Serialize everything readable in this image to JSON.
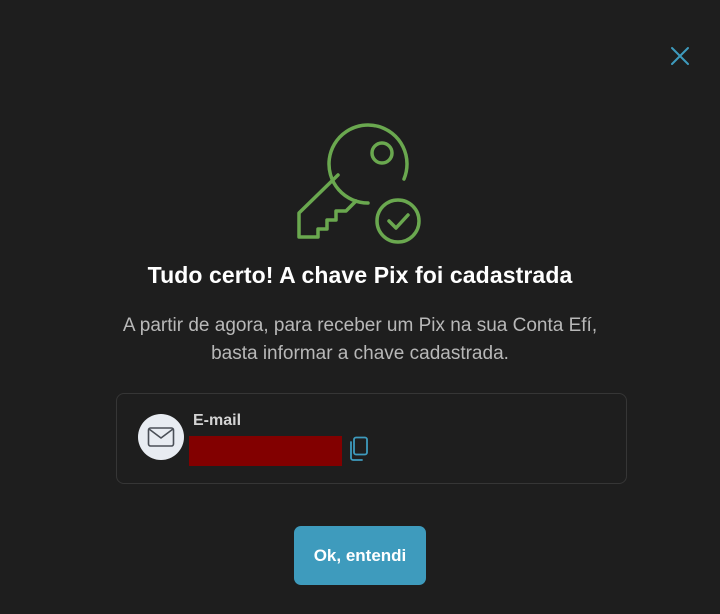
{
  "modal": {
    "title": "Tudo certo! A chave Pix foi cadastrada",
    "description": "A partir de agora, para receber um Pix na sua Conta Efí, basta informar a chave cadastrada.",
    "close_icon": "close-icon",
    "hero_icon": "key-with-check-icon"
  },
  "key_card": {
    "type_label": "E-mail",
    "value": "",
    "avatar_icon": "mail-icon",
    "copy_icon": "copy-icon"
  },
  "actions": {
    "confirm_label": "Ok, entendi"
  },
  "colors": {
    "background": "#1e1e1e",
    "accent": "#3e9bbd",
    "success_green": "#6aa84f",
    "redaction": "#820000"
  }
}
